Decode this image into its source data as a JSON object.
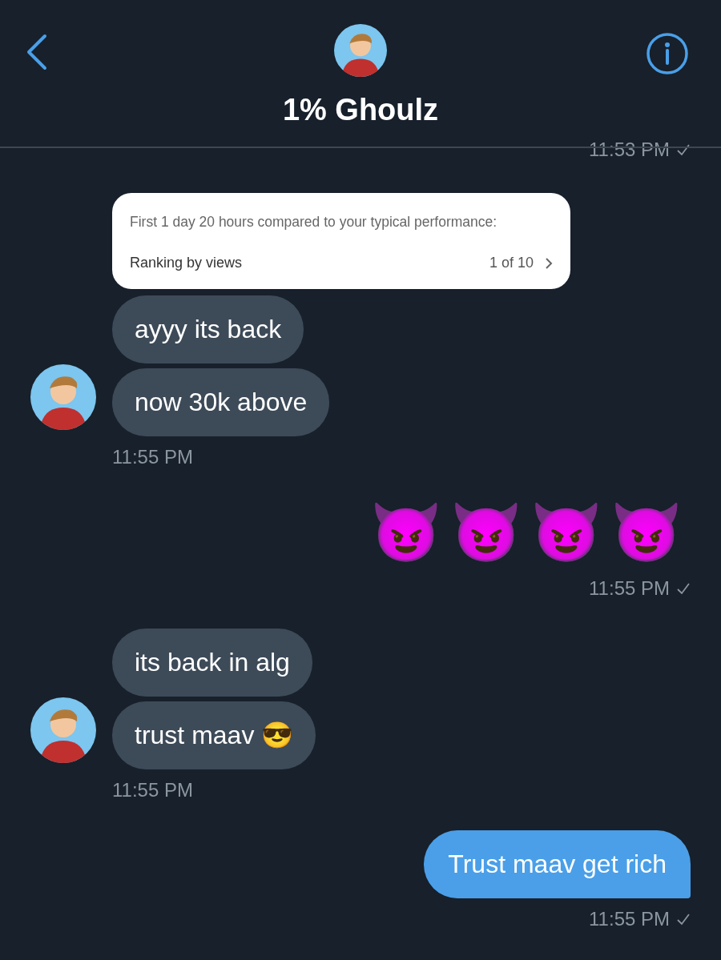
{
  "header": {
    "title": "1% Ghoulz"
  },
  "messages": [
    {
      "kind": "sent",
      "time": "11:53 PM",
      "read": true
    },
    {
      "kind": "received",
      "items": [
        {
          "kind": "card",
          "caption": "First 1 day 20 hours compared to your typical performance:",
          "label": "Ranking by views",
          "count": "1 of 10"
        },
        {
          "kind": "text",
          "text": "ayyy its back"
        },
        {
          "kind": "text",
          "text": "now 30k above"
        }
      ],
      "time": "11:55 PM"
    },
    {
      "kind": "sent",
      "items": [
        {
          "kind": "emoji",
          "text": "😈😈😈😈"
        }
      ],
      "time": "11:55 PM",
      "read": true
    },
    {
      "kind": "received",
      "items": [
        {
          "kind": "text",
          "text": "its back in alg"
        },
        {
          "kind": "text",
          "text": "trust maav 😎"
        }
      ],
      "time": "11:55 PM"
    },
    {
      "kind": "sent",
      "items": [
        {
          "kind": "text",
          "text": "Trust maav get rich"
        }
      ],
      "time": "11:55 PM",
      "read": true
    }
  ]
}
